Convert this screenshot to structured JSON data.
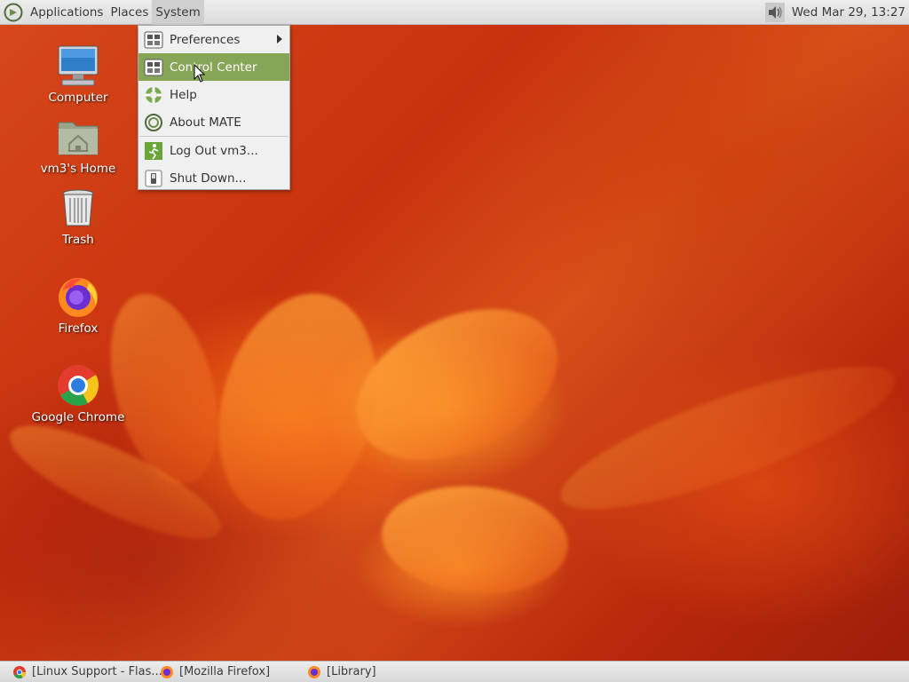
{
  "top_panel": {
    "menus": [
      "Applications",
      "Places",
      "System"
    ],
    "clock": "Wed Mar 29, 13:27",
    "icons": {
      "logo": "mate-logo-icon",
      "volume": "speaker-icon"
    }
  },
  "system_menu": {
    "items": [
      {
        "label": "Preferences",
        "icon": "preferences-icon",
        "submenu": true
      },
      {
        "label": "Control Center",
        "icon": "control-center-icon",
        "hovered": true
      },
      {
        "label": "Help",
        "icon": "help-lifebuoy-icon"
      },
      {
        "label": "About MATE",
        "icon": "mate-logo-icon"
      },
      {
        "label": "Log Out vm3...",
        "icon": "logout-icon"
      },
      {
        "label": "Shut Down...",
        "icon": "shutdown-icon"
      }
    ],
    "hover_color": "#87a556"
  },
  "desktop": {
    "icons": [
      {
        "label": "Computer",
        "icon": "computer-icon"
      },
      {
        "label": "vm3's Home",
        "icon": "home-folder-icon"
      },
      {
        "label": "Trash",
        "icon": "trash-icon"
      },
      {
        "label": "Firefox",
        "icon": "firefox-icon"
      },
      {
        "label": "Google Chrome",
        "icon": "chrome-icon"
      }
    ]
  },
  "taskbar": {
    "tasks": [
      {
        "label": "[Linux Support - Flas...",
        "icon": "chrome-icon"
      },
      {
        "label": "[Mozilla Firefox]",
        "icon": "firefox-icon"
      },
      {
        "label": "[Library]",
        "icon": "firefox-icon"
      }
    ]
  }
}
